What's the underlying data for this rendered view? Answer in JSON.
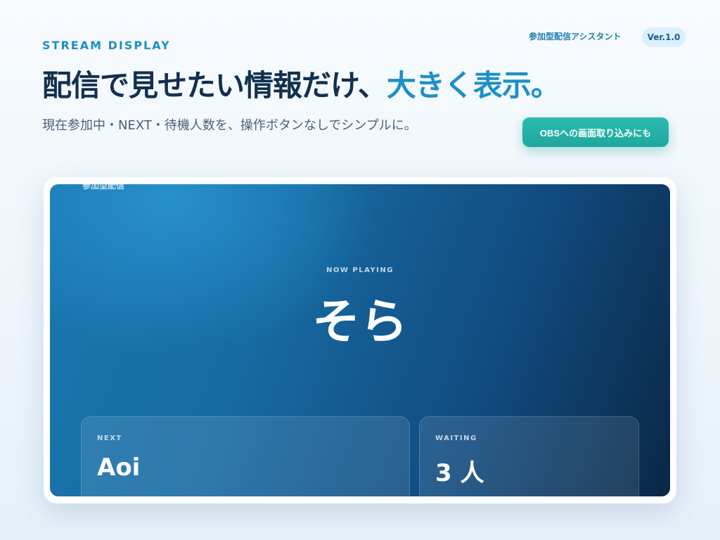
{
  "header": {
    "eyebrow": "STREAM DISPLAY",
    "app_name": "参加型配信アシスタント",
    "version": "Ver.1.0",
    "headline_main": "配信で見せたい情報だけ、",
    "headline_accent": "大きく表示。",
    "subline": "現在参加中・NEXT・待機人数を、操作ボタンなしでシンプルに。",
    "obs_button_label": "OBSへの画面取り込みにも"
  },
  "display": {
    "mini_title": "参加型配信",
    "now_playing_label": "NOW PLAYING",
    "now_playing_name": "そら",
    "next_label": "NEXT",
    "next_name": "Aoi",
    "waiting_label": "WAITING",
    "waiting_count": "3 人"
  },
  "colors": {
    "accent": "#1e8fc7",
    "button": "#22ada4",
    "screen_dark": "#0a2745"
  }
}
